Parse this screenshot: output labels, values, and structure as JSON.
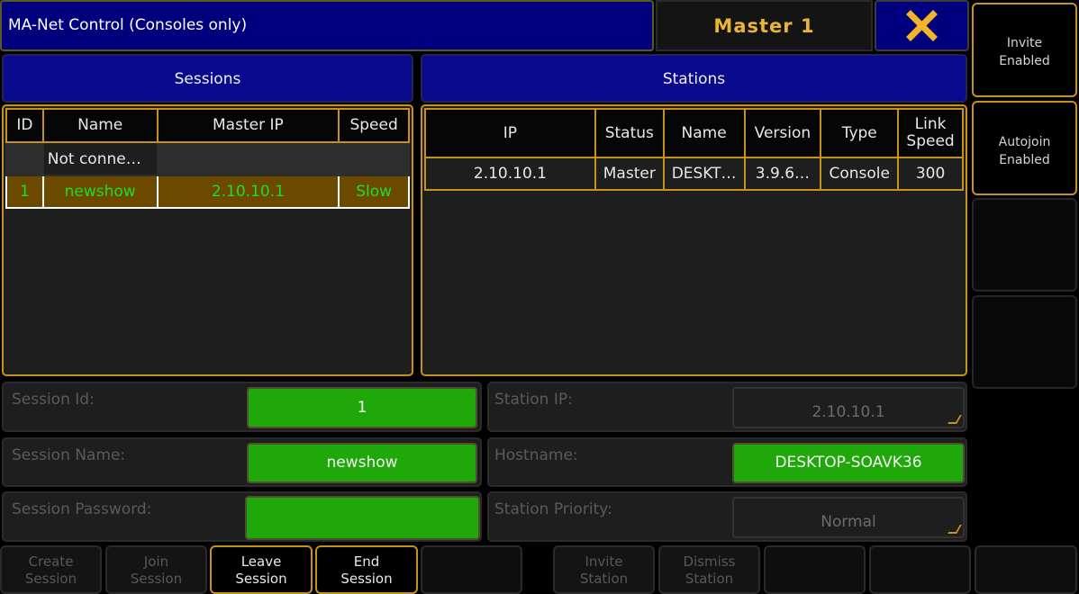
{
  "window": {
    "title": "MA-Net Control (Consoles only)",
    "master": "Master 1"
  },
  "side": {
    "invite": {
      "l1": "Invite",
      "l2": "Enabled"
    },
    "autojoin": {
      "l1": "Autojoin",
      "l2": "Enabled"
    }
  },
  "sessions": {
    "header": "Sessions",
    "columns": [
      "ID",
      "Name",
      "Master IP",
      "Speed"
    ],
    "rows": [
      [
        "",
        "Not conne…",
        "",
        ""
      ],
      [
        "1",
        "newshow",
        "2.10.10.1",
        "Slow"
      ]
    ]
  },
  "stations": {
    "header": "Stations",
    "columns": [
      "IP",
      "Status",
      "Name",
      "Version",
      "Type",
      "Link Speed"
    ],
    "link_l1": "Link",
    "link_l2": "Speed",
    "rows": [
      [
        "2.10.10.1",
        "Master",
        "DESKT…",
        "3.9.6…",
        "Console",
        "300"
      ]
    ]
  },
  "fields": {
    "session_id": {
      "label": "Session Id:",
      "value": "1"
    },
    "session_name": {
      "label": "Session Name:",
      "value": "newshow"
    },
    "session_password": {
      "label": "Session Password:",
      "value": ""
    },
    "station_ip": {
      "label": "Station IP:",
      "value": "2.10.10.1"
    },
    "hostname": {
      "label": "Hostname:",
      "value": "DESKTOP-SOAVK36"
    },
    "station_priority": {
      "label": "Station Priority:",
      "value": "Normal"
    }
  },
  "buttons": {
    "create": {
      "l1": "Create",
      "l2": "Session"
    },
    "join": {
      "l1": "Join",
      "l2": "Session"
    },
    "leave": {
      "l1": "Leave",
      "l2": "Session"
    },
    "end": {
      "l1": "End",
      "l2": "Session"
    },
    "invite": {
      "l1": "Invite",
      "l2": "Station"
    },
    "dismiss": {
      "l1": "Dismiss",
      "l2": "Station"
    }
  },
  "colors": {
    "accent": "#c8911e",
    "title_bg": "#00007f",
    "active_green": "#20a80a",
    "selected_text": "#20dd20",
    "master_text": "#eab531",
    "close_icon": "#f3b527"
  },
  "icons": {
    "close": "close-icon",
    "corner": "resize-corner-icon"
  }
}
